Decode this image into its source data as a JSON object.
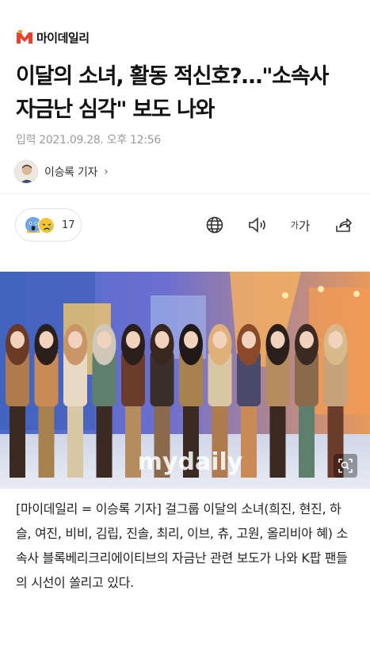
{
  "brand": {
    "name": "마이데일리",
    "accent": "#e8402e"
  },
  "article": {
    "headline": "이달의 소녀, 활동 적신호?…\"소속사 자금난 심각\" 보도 나와",
    "published": "입력 2021.09.28. 오후 12:56",
    "reporter": "이승록 기자",
    "reporter_chevron": "›",
    "body": "[마이데일리 = 이승록 기자] 걸그룹 이달의 소녀(희진, 현진, 하슬, 여진, 비비, 김립, 진솔, 최리, 이브, 츄, 고원, 올리비아 혜) 소속사 블록베리크리에이티브의 자금난 관련 보도가 나와 K팝 팬들의 시선이 쏠리고 있다."
  },
  "reactions": {
    "count": "17",
    "icons": [
      "fear-face-icon",
      "sad-face-icon"
    ]
  },
  "toolbar": {
    "icons": [
      "globe-icon",
      "speaker-icon",
      "font-size-icon",
      "share-icon"
    ],
    "font_size_small": "가",
    "font_size_large": "가"
  },
  "photo": {
    "watermark": "mydaily",
    "icon": "zoom-icon"
  }
}
